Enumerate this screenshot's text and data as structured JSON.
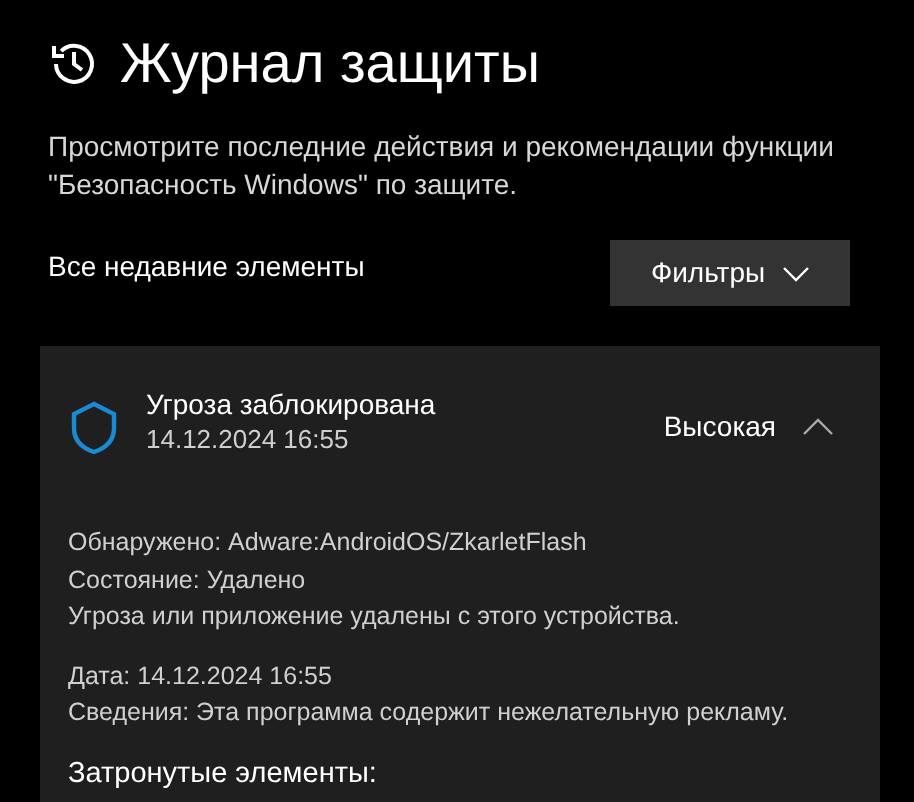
{
  "header": {
    "title": "Журнал защиты",
    "description": "Просмотрите последние действия и рекомендации функции \"Безопасность Windows\" по защите."
  },
  "list_label": "Все недавние элементы",
  "filter_button": {
    "label": "Фильтры"
  },
  "event": {
    "title": "Угроза заблокирована",
    "time": "14.12.2024 16:55",
    "severity": "Высокая",
    "expanded": true,
    "detail_groups": [
      [
        "Обнаружено: Adware:AndroidOS/ZkarletFlash",
        "Состояние: Удалено",
        "Угроза или приложение удалены с этого устройства."
      ],
      [
        "Дата: 14.12.2024 16:55",
        "Сведения: Эта программа содержит нежелательную рекламу."
      ]
    ],
    "affected_heading": "Затронутые элементы:"
  }
}
